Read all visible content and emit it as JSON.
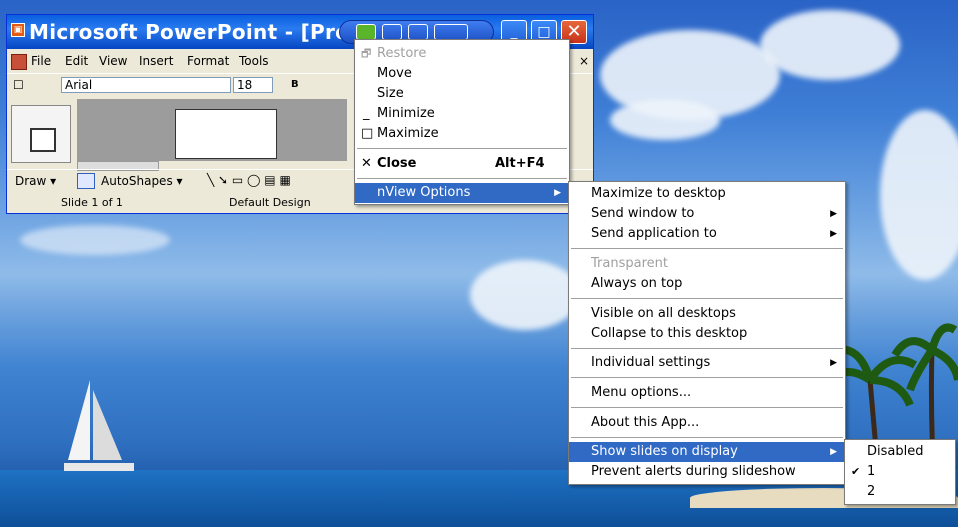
{
  "window": {
    "title": "Microsoft PowerPoint - [Pre",
    "app_icon_glyph": "▣",
    "minimize_glyph": "_",
    "maximize_glyph": "□",
    "close_glyph": "✕"
  },
  "menubar": {
    "items": [
      "File",
      "Edit",
      "View",
      "Insert",
      "Format",
      "Tools"
    ],
    "overflow": "×"
  },
  "toolbar": {
    "font_name": "Arial",
    "font_size": "18",
    "bold": "B"
  },
  "drawbar": {
    "draw": "Draw ▾",
    "autoshapes": "AutoShapes ▾"
  },
  "statusbar": {
    "slide": "Slide 1 of 1",
    "design": "Default Design"
  },
  "system_menu": {
    "restore": "Restore",
    "move": "Move",
    "size": "Size",
    "minimize": "Minimize",
    "maximize": "Maximize",
    "close": "Close",
    "close_shortcut": "Alt+F4",
    "nview": "nView Options"
  },
  "nview_menu": {
    "maximize_desktop": "Maximize to desktop",
    "send_window": "Send window to",
    "send_app": "Send application to",
    "transparent": "Transparent",
    "always_on_top": "Always on top",
    "visible_all": "Visible on all desktops",
    "collapse": "Collapse to this desktop",
    "individual": "Individual settings",
    "menu_options": "Menu options...",
    "about": "About this App...",
    "show_slides": "Show slides on display",
    "prevent_alerts": "Prevent alerts during slideshow"
  },
  "slides_menu": {
    "disabled": "Disabled",
    "opt1": "1",
    "opt2": "2",
    "check": "✔"
  },
  "colors": {
    "highlight": "#316ac5",
    "titlebar": "#0a5fde"
  }
}
